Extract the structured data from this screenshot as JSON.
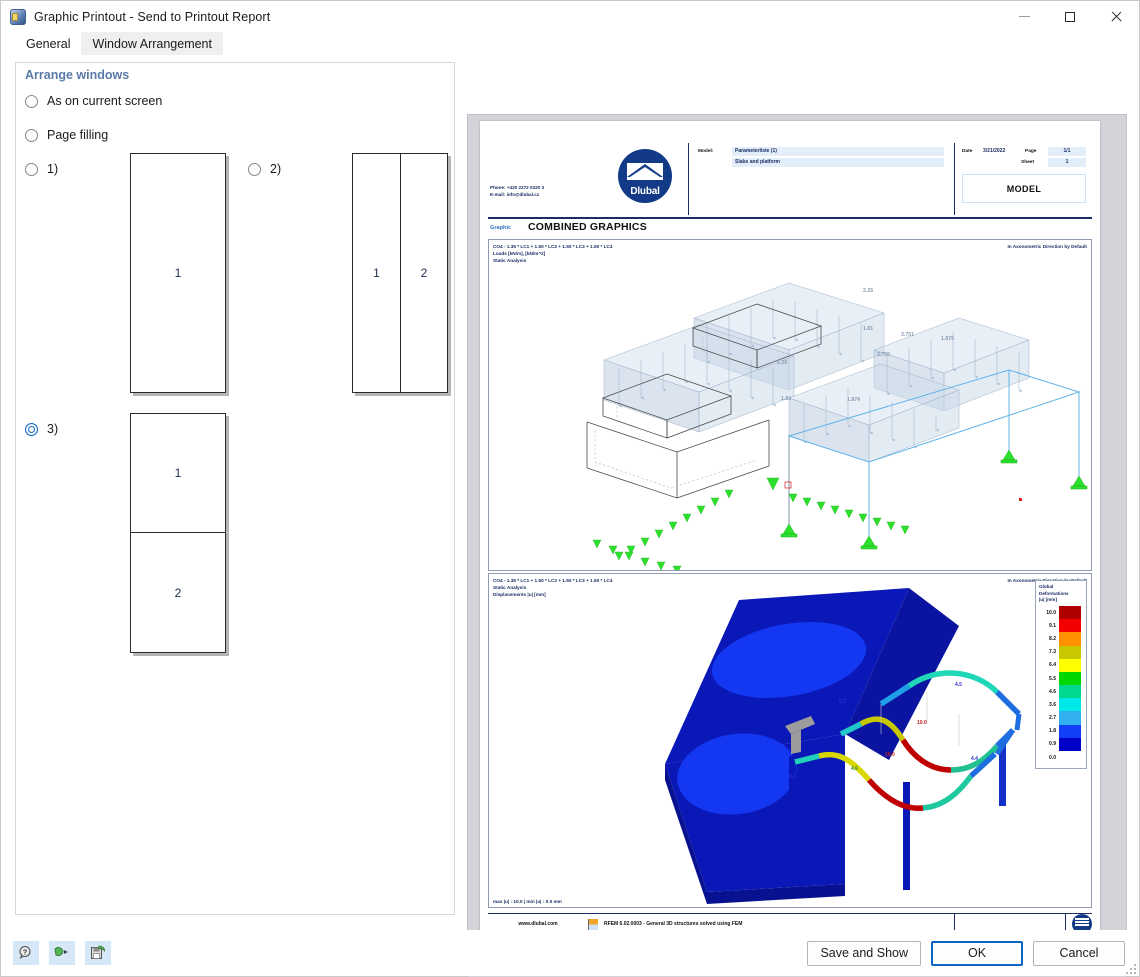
{
  "window": {
    "title": "Graphic Printout - Send to Printout Report",
    "icon": "printout-icon",
    "minimize": "minimize-icon",
    "maximize": "maximize-icon",
    "close": "close-icon"
  },
  "tabs": [
    {
      "label": "General",
      "active": false
    },
    {
      "label": "Window Arrangement",
      "active": true
    }
  ],
  "left_panel": {
    "group_title": "Arrange windows",
    "options": [
      {
        "label": "As on current screen",
        "selected": false
      },
      {
        "label": "Page filling",
        "selected": false
      },
      {
        "label": "1)",
        "selected": false
      },
      {
        "label": "2)",
        "selected": false
      },
      {
        "label": "3)",
        "selected": true
      }
    ],
    "layout_1_cells": [
      "1"
    ],
    "layout_2_cells": [
      "1",
      "2"
    ],
    "layout_3_cells": [
      "1",
      "2"
    ]
  },
  "preview": {
    "header": {
      "phone": "Phone: +420 2272 0320 3",
      "email": "E-mail: info@dlubal.cz",
      "logo_text": "Dlubal",
      "model_label": "Model:",
      "model_name": "Parameterliste (1)",
      "model_subtitle": "Slabs and platform",
      "date_label": "Date",
      "date_value": "3/21/2022",
      "page_label": "Page",
      "page_value": "1/1",
      "sheet_label": "Sheet",
      "sheet_value": "1",
      "model_box": "MODEL"
    },
    "section": {
      "tag": "Graphic",
      "title": "COMBINED GRAPHICS"
    },
    "graphic1": {
      "label": "CO4 - 1.35 * LC1 + 1.50 * LC2 + 1.50 * LC3 + 1.50 * LC4\nLoads [kN/m], [kN/m^2]\nStatic Analysis",
      "right_label": "In Axonometric Direction by Default",
      "load_values": [
        "2.25",
        "1.81",
        "3.751",
        "1.875",
        "3.750",
        "2.25",
        "1.81",
        "1.874"
      ]
    },
    "graphic2": {
      "label": "CO4 - 1.35 * LC1 + 1.50 * LC2 + 1.50 * LC3 + 1.50 * LC4\nStatic Analysis\nDisplacements |u| [mm]",
      "right_label": "In Axonometric Direction by Default",
      "bottom_label": "max |u| : 10.0 | min |u| : 0.0 mm",
      "value_labels": [
        "0.7",
        "0.3",
        "4.6",
        "10.0",
        "10.0",
        "4.5",
        "4.4"
      ],
      "legend": {
        "title": "Global\nDeformations\n|u| [mm]",
        "values": [
          "10.0",
          "9.1",
          "8.2",
          "7.3",
          "6.4",
          "5.5",
          "4.6",
          "3.6",
          "2.7",
          "1.8",
          "0.9",
          "0.0"
        ],
        "colors": [
          "#b00000",
          "#f50000",
          "#ff9000",
          "#c8c800",
          "#ffff00",
          "#00d800",
          "#00d890",
          "#00e8e8",
          "#30b0f0",
          "#1040f8",
          "#0000c8",
          "#000080"
        ]
      }
    },
    "footer": {
      "url": "www.dlubal.com",
      "description": "RFEM 6.02.0003 - General 3D structures solved using FEM"
    }
  },
  "bottom_bar": {
    "tools": [
      {
        "name": "help-icon",
        "glyph": "?"
      },
      {
        "name": "export-icon",
        "glyph": "➤"
      },
      {
        "name": "save-settings-icon",
        "glyph": "💾"
      }
    ],
    "buttons": [
      {
        "label": "Save and Show",
        "default": false
      },
      {
        "label": "OK",
        "default": true
      },
      {
        "label": "Cancel",
        "default": false
      }
    ]
  },
  "colors": {
    "accent": "#0a66c2",
    "group_title": "#5a7aa8",
    "report_navy": "#1b2b63",
    "logo_blue": "#123a87"
  }
}
